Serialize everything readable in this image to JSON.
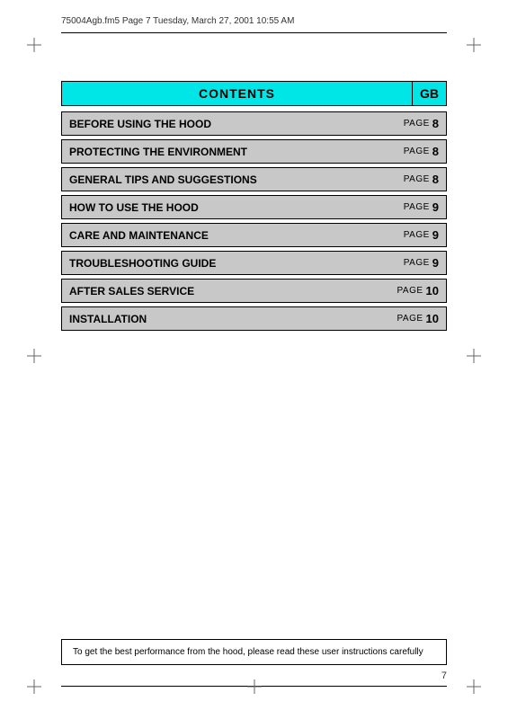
{
  "header": {
    "file_info": "75004Agb.fm5  Page 7  Tuesday, March 27, 2001  10:55 AM"
  },
  "contents": {
    "title": "CONTENTS",
    "gb_label": "GB",
    "rows": [
      {
        "title": "BEFORE USING THE HOOD",
        "page_label": "PAGE",
        "page_num": "8"
      },
      {
        "title": "PROTECTING THE ENVIRONMENT",
        "page_label": "PAGE",
        "page_num": "8"
      },
      {
        "title": "GENERAL TIPS AND SUGGESTIONS",
        "page_label": "PAGE",
        "page_num": "8"
      },
      {
        "title": "HOW TO USE THE HOOD",
        "page_label": "PAGE",
        "page_num": "9"
      },
      {
        "title": "CARE AND MAINTENANCE",
        "page_label": "PAGE",
        "page_num": "9"
      },
      {
        "title": "TROUBLESHOOTING GUIDE",
        "page_label": "PAGE",
        "page_num": "9"
      },
      {
        "title": "AFTER SALES SERVICE",
        "page_label": "PAGE",
        "page_num": "10"
      },
      {
        "title": "INSTALLATION",
        "page_label": "PAGE",
        "page_num": "10"
      }
    ]
  },
  "bottom_note": "To get the best performance from the hood, please read these user instructions carefully",
  "page_number": "7"
}
